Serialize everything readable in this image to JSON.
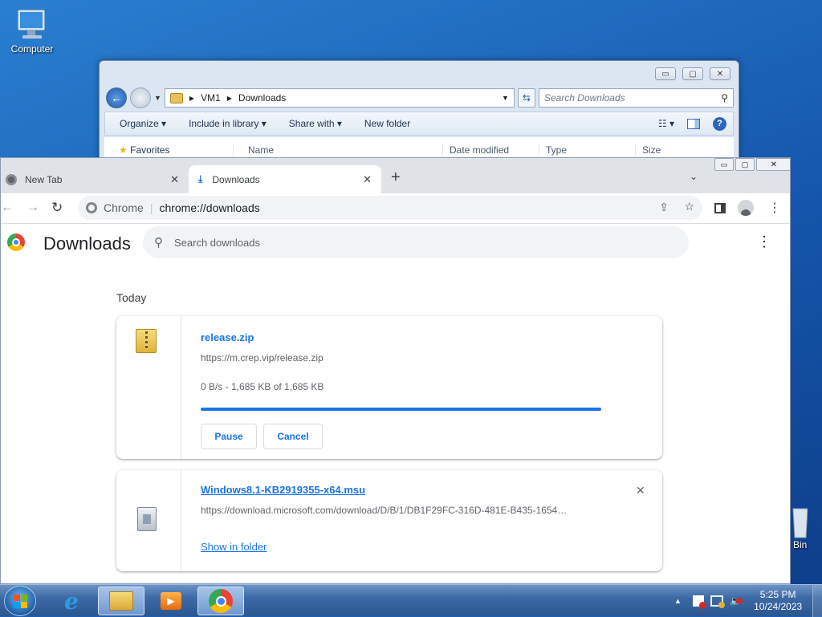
{
  "desktop": {
    "computer_label": "Computer",
    "bin_label": "Bin"
  },
  "explorer": {
    "breadcrumb": [
      "VM1",
      "Downloads"
    ],
    "search_placeholder": "Search Downloads",
    "toolbar": {
      "organize": "Organize",
      "include": "Include in library",
      "share": "Share with",
      "new_folder": "New folder"
    },
    "nav_favorites": "Favorites",
    "columns": [
      "Name",
      "Date modified",
      "Type",
      "Size"
    ]
  },
  "chrome": {
    "tabs": [
      {
        "label": "New Tab",
        "icon": "chrome-icon"
      },
      {
        "label": "Downloads",
        "icon": "download-icon"
      }
    ],
    "omnibox": {
      "site": "Chrome",
      "url": "chrome://downloads"
    },
    "page_title": "Downloads",
    "search_placeholder": "Search downloads",
    "section": "Today",
    "downloads": [
      {
        "filename": "release.zip",
        "url": "https://m.crep.vip/release.zip",
        "status": "0 B/s - 1,685 KB of 1,685 KB",
        "progress": 1.0,
        "buttons": [
          "Pause",
          "Cancel"
        ]
      },
      {
        "filename": "Windows8.1-KB2919355-x64.msu",
        "url": "https://download.microsoft.com/download/D/B/1/DB1F29FC-316D-481E-B435-1654…",
        "link": "Show in folder"
      }
    ],
    "accent": "#1a73e8"
  },
  "taskbar": {
    "time": "5:25 PM",
    "date": "10/24/2023"
  }
}
